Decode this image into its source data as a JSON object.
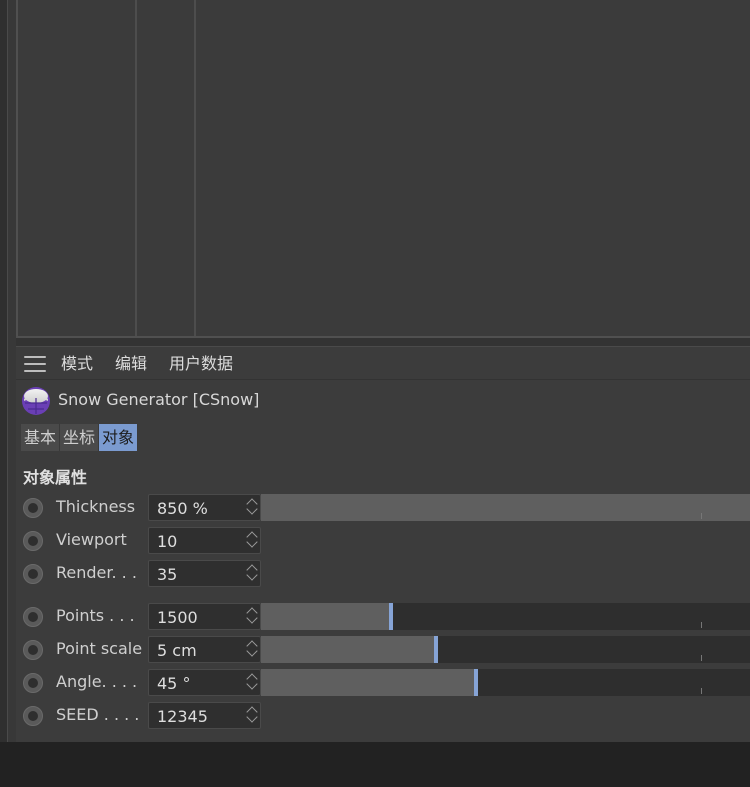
{
  "menu": {
    "items": [
      "模式",
      "编辑",
      "用户数据"
    ]
  },
  "object": {
    "title": "Snow Generator [CSnow]",
    "icon": "snow-generator-icon"
  },
  "tabs": [
    {
      "label": "基本",
      "active": false
    },
    {
      "label": "坐标",
      "active": false
    },
    {
      "label": "对象",
      "active": true
    }
  ],
  "section": {
    "title": "对象属性"
  },
  "params": [
    {
      "label": "Thickness",
      "value": "850 %",
      "slider": true,
      "fraction": 1.0
    },
    {
      "label": "Viewport",
      "value": "10",
      "slider": false
    },
    {
      "label": "Render. . .",
      "value": "35",
      "slider": false
    },
    {
      "label": "Points . . .",
      "value": "1500",
      "slider": true,
      "fraction": 0.265
    },
    {
      "label": "Point scale",
      "value": "5 cm",
      "slider": true,
      "fraction": 0.358
    },
    {
      "label": "Angle. . . .",
      "value": "45 °",
      "slider": true,
      "fraction": 0.44
    },
    {
      "label": "SEED . . . .",
      "value": "12345",
      "slider": false
    }
  ],
  "colors": {
    "accent": "#7b9bd0",
    "slider_knob": "#86a4d6",
    "panel_bg": "#3c3c3c"
  }
}
